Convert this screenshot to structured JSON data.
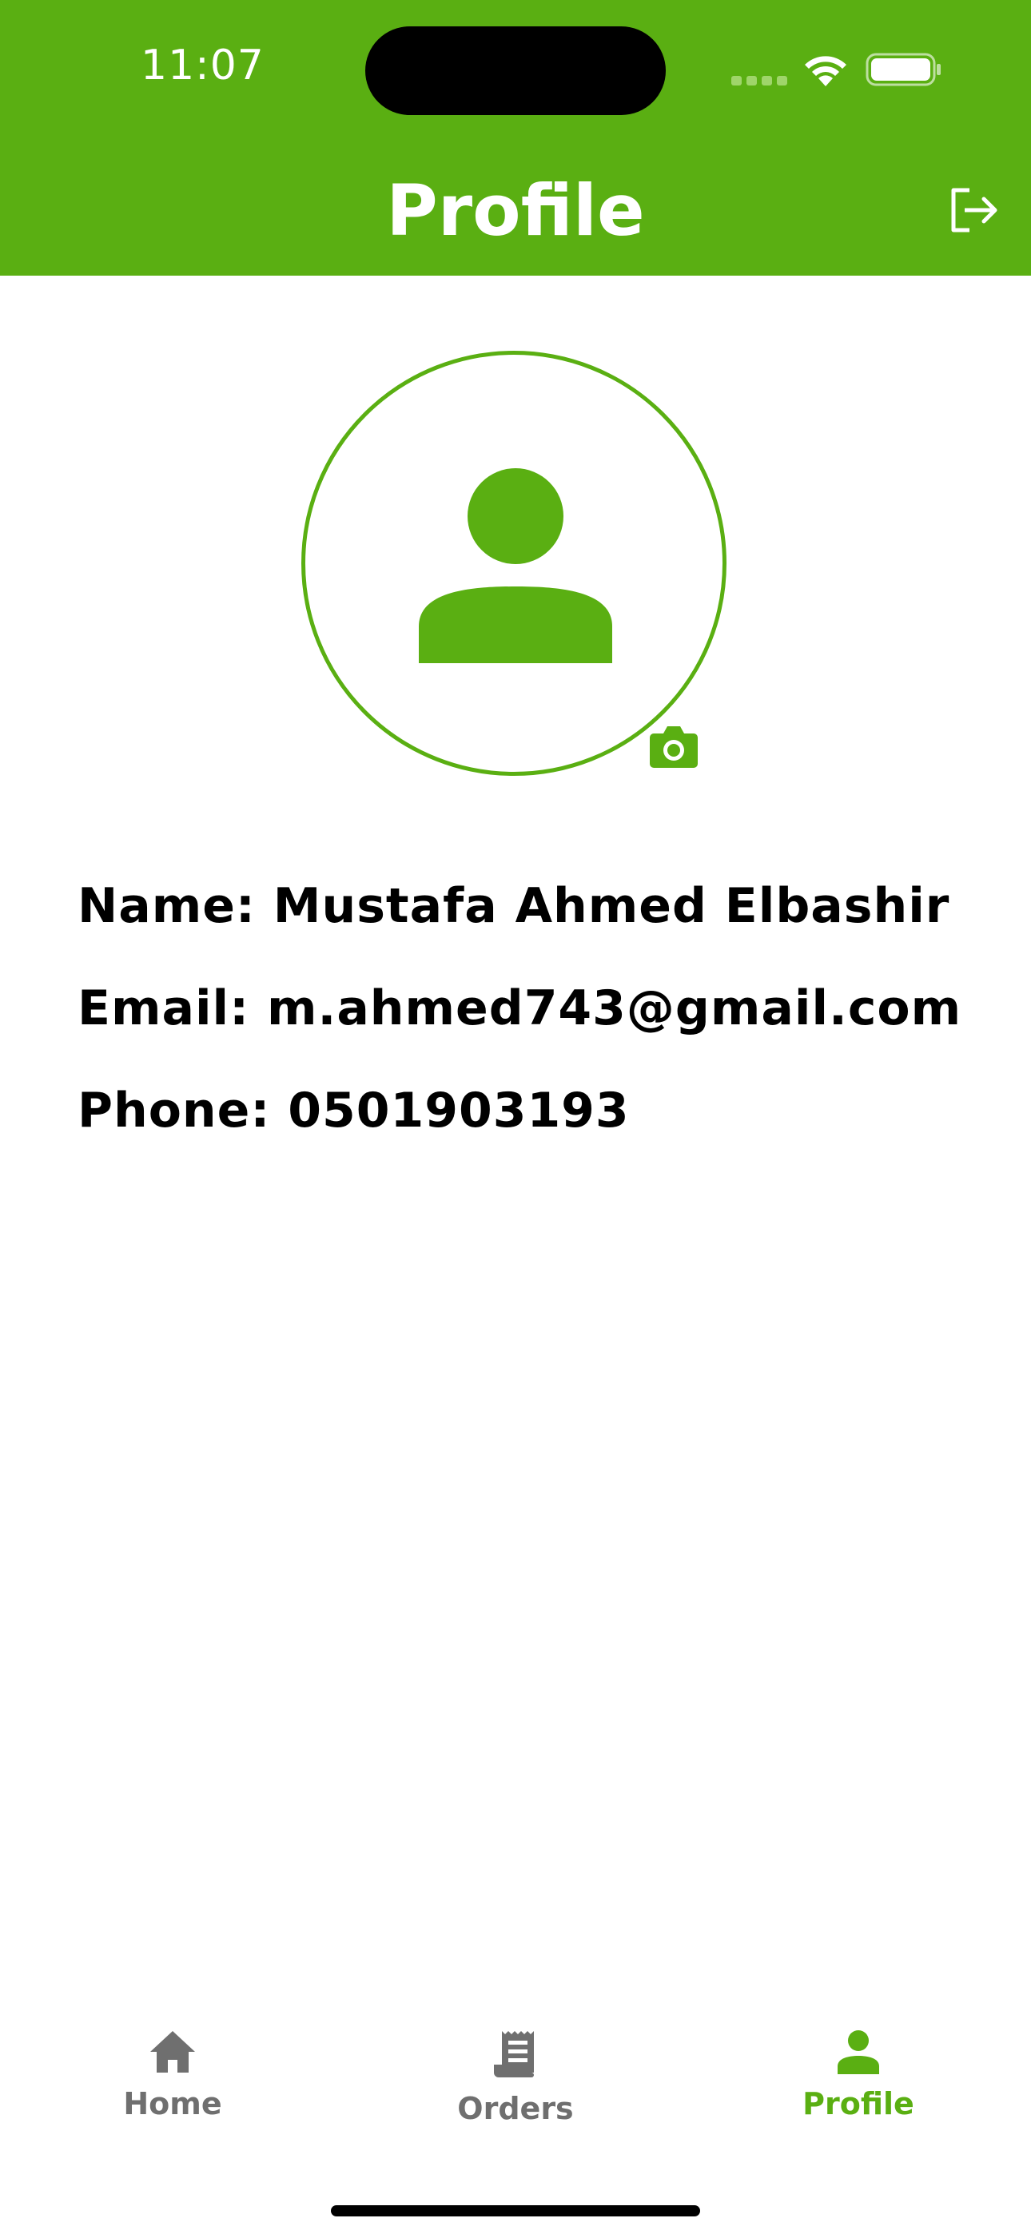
{
  "status_bar": {
    "time": "11:07"
  },
  "header": {
    "title": "Profile",
    "logout_icon": "logout-icon",
    "background_color": "#5aaf12"
  },
  "avatar": {
    "icon": "person-icon",
    "camera_icon": "camera-icon"
  },
  "profile": {
    "name_line": "Name: Mustafa Ahmed Elbashir",
    "email_line": "Email: m.ahmed743@gmail.com",
    "phone_line": "Phone: 0501903193"
  },
  "tabs": [
    {
      "label": "Home",
      "icon": "home-icon",
      "active": false
    },
    {
      "label": "Orders",
      "icon": "receipt-icon",
      "active": false
    },
    {
      "label": "Profile",
      "icon": "person-icon",
      "active": true
    }
  ],
  "colors": {
    "accent": "#5aaf12",
    "inactive": "#6f6f6f"
  }
}
